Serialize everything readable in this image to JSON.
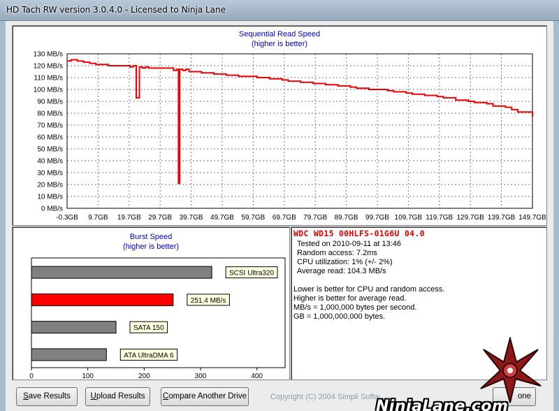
{
  "window": {
    "title": "HD Tach RW version 3.0.4.0 - Licensed to Ninja Lane"
  },
  "colors": {
    "read_line": "#ee0000",
    "title_blue": "#0000cc",
    "bar_gray": "#808080",
    "bar_highlight": "#ff0000"
  },
  "chart_data": [
    {
      "type": "line",
      "title": "Sequential Read Speed",
      "subtitle": "(higher is better)",
      "y_unit": "MB/s",
      "ylim": [
        0,
        130
      ],
      "y_ticks": [
        "130 MB/s",
        "120 MB/s",
        "110 MB/s",
        "100 MB/s",
        "90 MB/s",
        "80 MB/s",
        "70 MB/s",
        "60 MB/s",
        "50 MB/s",
        "40 MB/s",
        "30 MB/s",
        "20 MB/s",
        "10 MB/s",
        "0 MB/s"
      ],
      "x_ticks": [
        "-0.3GB",
        "9.7GB",
        "19.7GB",
        "29.7GB",
        "39.7GB",
        "49.7GB",
        "59.7GB",
        "69.7GB",
        "79.7GB",
        "89.7GB",
        "99.7GB",
        "109.7GB",
        "119.7GB",
        "129.7GB",
        "139.7GB",
        "149.7GB"
      ],
      "xlim": [
        -0.3,
        149.7
      ],
      "grid": true,
      "series": [
        {
          "x": [
            -0.3,
            1,
            3,
            5,
            7,
            9,
            11,
            13,
            15,
            17,
            19,
            20,
            21,
            22,
            23,
            24,
            25,
            26,
            28,
            30,
            32,
            34,
            35,
            35.6,
            36,
            37,
            38,
            39,
            41,
            43,
            45,
            47,
            49,
            51,
            53,
            55,
            57,
            59,
            61,
            63,
            65,
            67,
            69,
            71,
            73,
            75,
            77,
            79,
            81,
            83,
            85,
            87,
            89,
            91,
            93,
            95,
            97,
            99,
            101,
            103,
            105,
            107,
            109,
            111,
            113,
            115,
            117,
            119,
            121,
            123,
            125,
            127,
            129,
            131,
            133,
            135,
            137,
            139,
            141,
            143,
            145,
            147,
            149.7
          ],
          "y": [
            124,
            125,
            124,
            123,
            122,
            121,
            121,
            120,
            120,
            120,
            120,
            119,
            120,
            93,
            119,
            118,
            119,
            118,
            118,
            118,
            118,
            116,
            117,
            21,
            117,
            116,
            117,
            115,
            115,
            114,
            114,
            113,
            113,
            112,
            112,
            111,
            111,
            111,
            110,
            110,
            109,
            109,
            108,
            107,
            107,
            106,
            106,
            105,
            105,
            104,
            104,
            103,
            103,
            102,
            101,
            101,
            100,
            100,
            100,
            99,
            98,
            98,
            97,
            96,
            96,
            95,
            95,
            94,
            93,
            93,
            91,
            91,
            90,
            89,
            89,
            88,
            86,
            86,
            85,
            83,
            81,
            81,
            77
          ]
        }
      ]
    },
    {
      "type": "bar",
      "orientation": "horizontal",
      "title": "Burst Speed",
      "subtitle": "(higher is better)",
      "categories": [
        "SCSI Ultra320",
        "251.4 MB/s",
        "SATA 150",
        "ATA UltraDMA 6"
      ],
      "values": [
        320,
        251.4,
        150,
        133
      ],
      "highlight": [
        false,
        true,
        false,
        false
      ],
      "xlim": [
        0,
        450
      ],
      "x_ticks": [
        "0",
        "100",
        "200",
        "300",
        "400"
      ],
      "grid": false
    }
  ],
  "info": {
    "drive": "WDC WD15 00HLFS-01G6U 04.0",
    "tested": "Tested on 2010-09-11 at 13:46",
    "random_access": "Random access: 7.2ms",
    "cpu": "CPU utilization: 1% (+/- 2%)",
    "avg_read": "Average read: 104.3 MB/s",
    "notes": [
      "Lower is better for CPU and random access.",
      "Higher is better for average read.",
      "MB/s = 1,000,000 bytes per second.",
      "GB = 1,000,000,000 bytes."
    ]
  },
  "buttons": {
    "save": {
      "prefix": "",
      "ul": "S",
      "rest": "ave Results"
    },
    "upload": {
      "prefix": "",
      "ul": "U",
      "rest": "pload Results"
    },
    "compare": {
      "prefix": "",
      "ul": "C",
      "rest": "ompare Another Drive"
    },
    "done": "one"
  },
  "footer": {
    "copyright": "Copyright (C) 2004 Simpli Softw",
    "watermark": "NinjaLane.com"
  }
}
